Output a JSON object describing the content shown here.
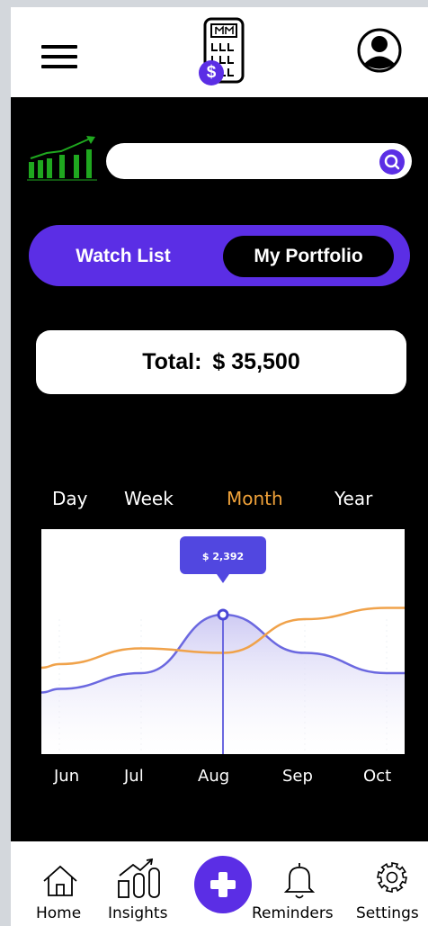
{
  "header": {
    "menu_icon": "hamburger-menu-icon",
    "logo_icon": "calculator-dollar-icon",
    "logo_badge": "$",
    "profile_icon": "user-avatar-icon"
  },
  "search": {
    "value": "",
    "placeholder": "",
    "icon": "search-icon"
  },
  "toggle": {
    "options": [
      {
        "label": "Watch List",
        "active": false
      },
      {
        "label": "My Portfolio",
        "active": true
      }
    ]
  },
  "total": {
    "label": "Total:",
    "value": "$ 35,500"
  },
  "periods": [
    {
      "label": "Day",
      "active": false
    },
    {
      "label": "Week",
      "active": false
    },
    {
      "label": "Month",
      "active": true
    },
    {
      "label": "Year",
      "active": false
    }
  ],
  "chart_data": {
    "type": "line",
    "x": [
      "Jun",
      "Jul",
      "Aug",
      "Sep",
      "Oct"
    ],
    "series": [
      {
        "color": "#6b68e0",
        "values": [
          0.29,
          0.36,
          0.62,
          0.45,
          0.36
        ]
      },
      {
        "color": "#f0a24a",
        "values": [
          0.4,
          0.47,
          0.45,
          0.6,
          0.65
        ]
      }
    ],
    "highlight": {
      "x": "Aug",
      "label": "$ 2,392"
    },
    "colors": {
      "tooltip": "#5147e0",
      "fill": "#d9d6f6"
    }
  },
  "months": [
    "Jun",
    "Jul",
    "Aug",
    "Sep",
    "Oct"
  ],
  "nav": {
    "items": [
      {
        "label": "Home",
        "icon": "home-icon"
      },
      {
        "label": "Insights",
        "icon": "insights-chart-icon"
      },
      {
        "label": "",
        "icon": "plus-icon"
      },
      {
        "label": "Reminders",
        "icon": "bell-icon"
      },
      {
        "label": "Settings",
        "icon": "gear-icon"
      }
    ]
  },
  "colors": {
    "accent": "#5b2ee5",
    "active_period": "#f0a23a",
    "trend_green": "#1fa81f"
  }
}
